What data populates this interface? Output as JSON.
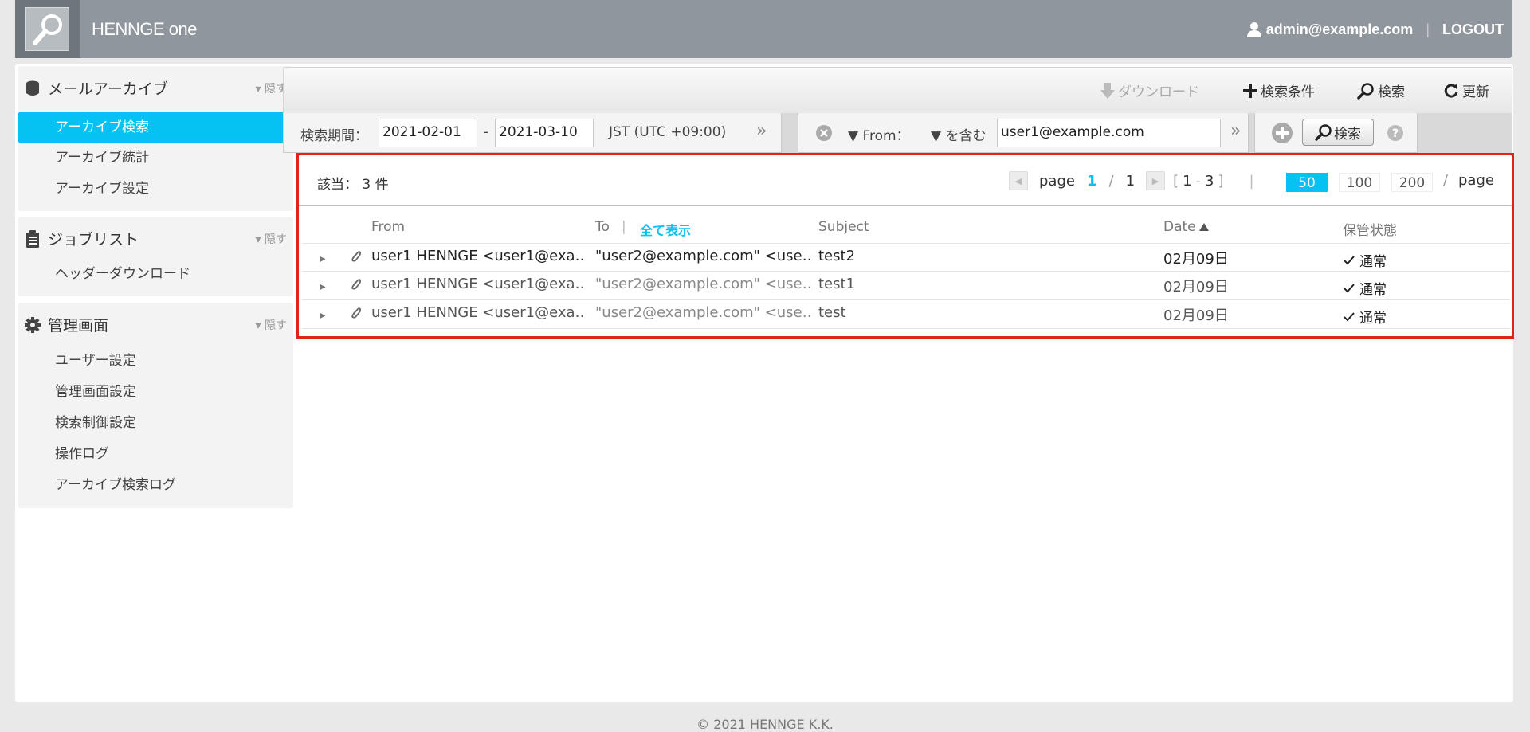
{
  "header": {
    "brand": "HENNGE one",
    "user": "admin@example.com",
    "separator": "|",
    "logout": "LOGOUT"
  },
  "sidebar": {
    "sections": [
      {
        "title": "メールアーカイブ",
        "icon": "database-icon",
        "hide": "隠す",
        "items": [
          {
            "label": "アーカイブ検索",
            "active": true
          },
          {
            "label": "アーカイブ統計"
          },
          {
            "label": "アーカイブ設定"
          }
        ]
      },
      {
        "title": "ジョブリスト",
        "icon": "clipboard-icon",
        "hide": "隠す",
        "items": [
          {
            "label": "ヘッダーダウンロード"
          }
        ]
      },
      {
        "title": "管理画面",
        "icon": "gear-icon",
        "hide": "隠す",
        "items": [
          {
            "label": "ユーザー設定"
          },
          {
            "label": "管理画面設定"
          },
          {
            "label": "検索制御設定"
          },
          {
            "label": "操作ログ"
          },
          {
            "label": "アーカイブ検索ログ"
          }
        ]
      }
    ]
  },
  "toolbar": {
    "download": "ダウンロード",
    "search_conditions": "検索条件",
    "search": "検索",
    "refresh": "更新"
  },
  "filter": {
    "period_label": "検索期間：",
    "date_from": "2021-02-01",
    "date_sep": "-",
    "date_to": "2021-03-10",
    "timezone": "JST (UTC +09:00)",
    "field": "From：",
    "operator": "を含む",
    "value": "user1@example.com",
    "search_button": "検索",
    "chevron": "»"
  },
  "results": {
    "count_label": "該当：",
    "count_value": "3 件",
    "pager": {
      "page_word": "page",
      "current": "1",
      "slash": "/",
      "total": "1",
      "range_open": "[",
      "range_from": "1",
      "range_dash": "-",
      "range_to": "3",
      "range_close": "]",
      "pipe": "|",
      "sizes": [
        "50",
        "100",
        "200"
      ],
      "active_size": "50",
      "size_suffix_slash": "/",
      "size_suffix": "page"
    },
    "columns": {
      "from": "From",
      "to": "To",
      "to_sep": "|",
      "show_all": "全て表示",
      "subject": "Subject",
      "date": "Date",
      "status": "保管状態"
    },
    "rows": [
      {
        "from": "user1 HENNGE <user1@exa…",
        "to": "\"user2@example.com\" <use…",
        "subject": "test2",
        "date": "02月09日",
        "status": "通常",
        "unread": true
      },
      {
        "from": "user1 HENNGE <user1@exa…",
        "to": "\"user2@example.com\" <use…",
        "subject": "test1",
        "date": "02月09日",
        "status": "通常",
        "unread": false
      },
      {
        "from": "user1 HENNGE <user1@exa…",
        "to": "\"user2@example.com\" <use…",
        "subject": "test",
        "date": "02月09日",
        "status": "通常",
        "unread": false
      }
    ]
  },
  "footer": {
    "copyright": "© 2021 HENNGE K.K."
  },
  "colors": {
    "accent": "#06c2f3",
    "header_bg": "#8f969d",
    "highlight_border": "#e2231a"
  }
}
